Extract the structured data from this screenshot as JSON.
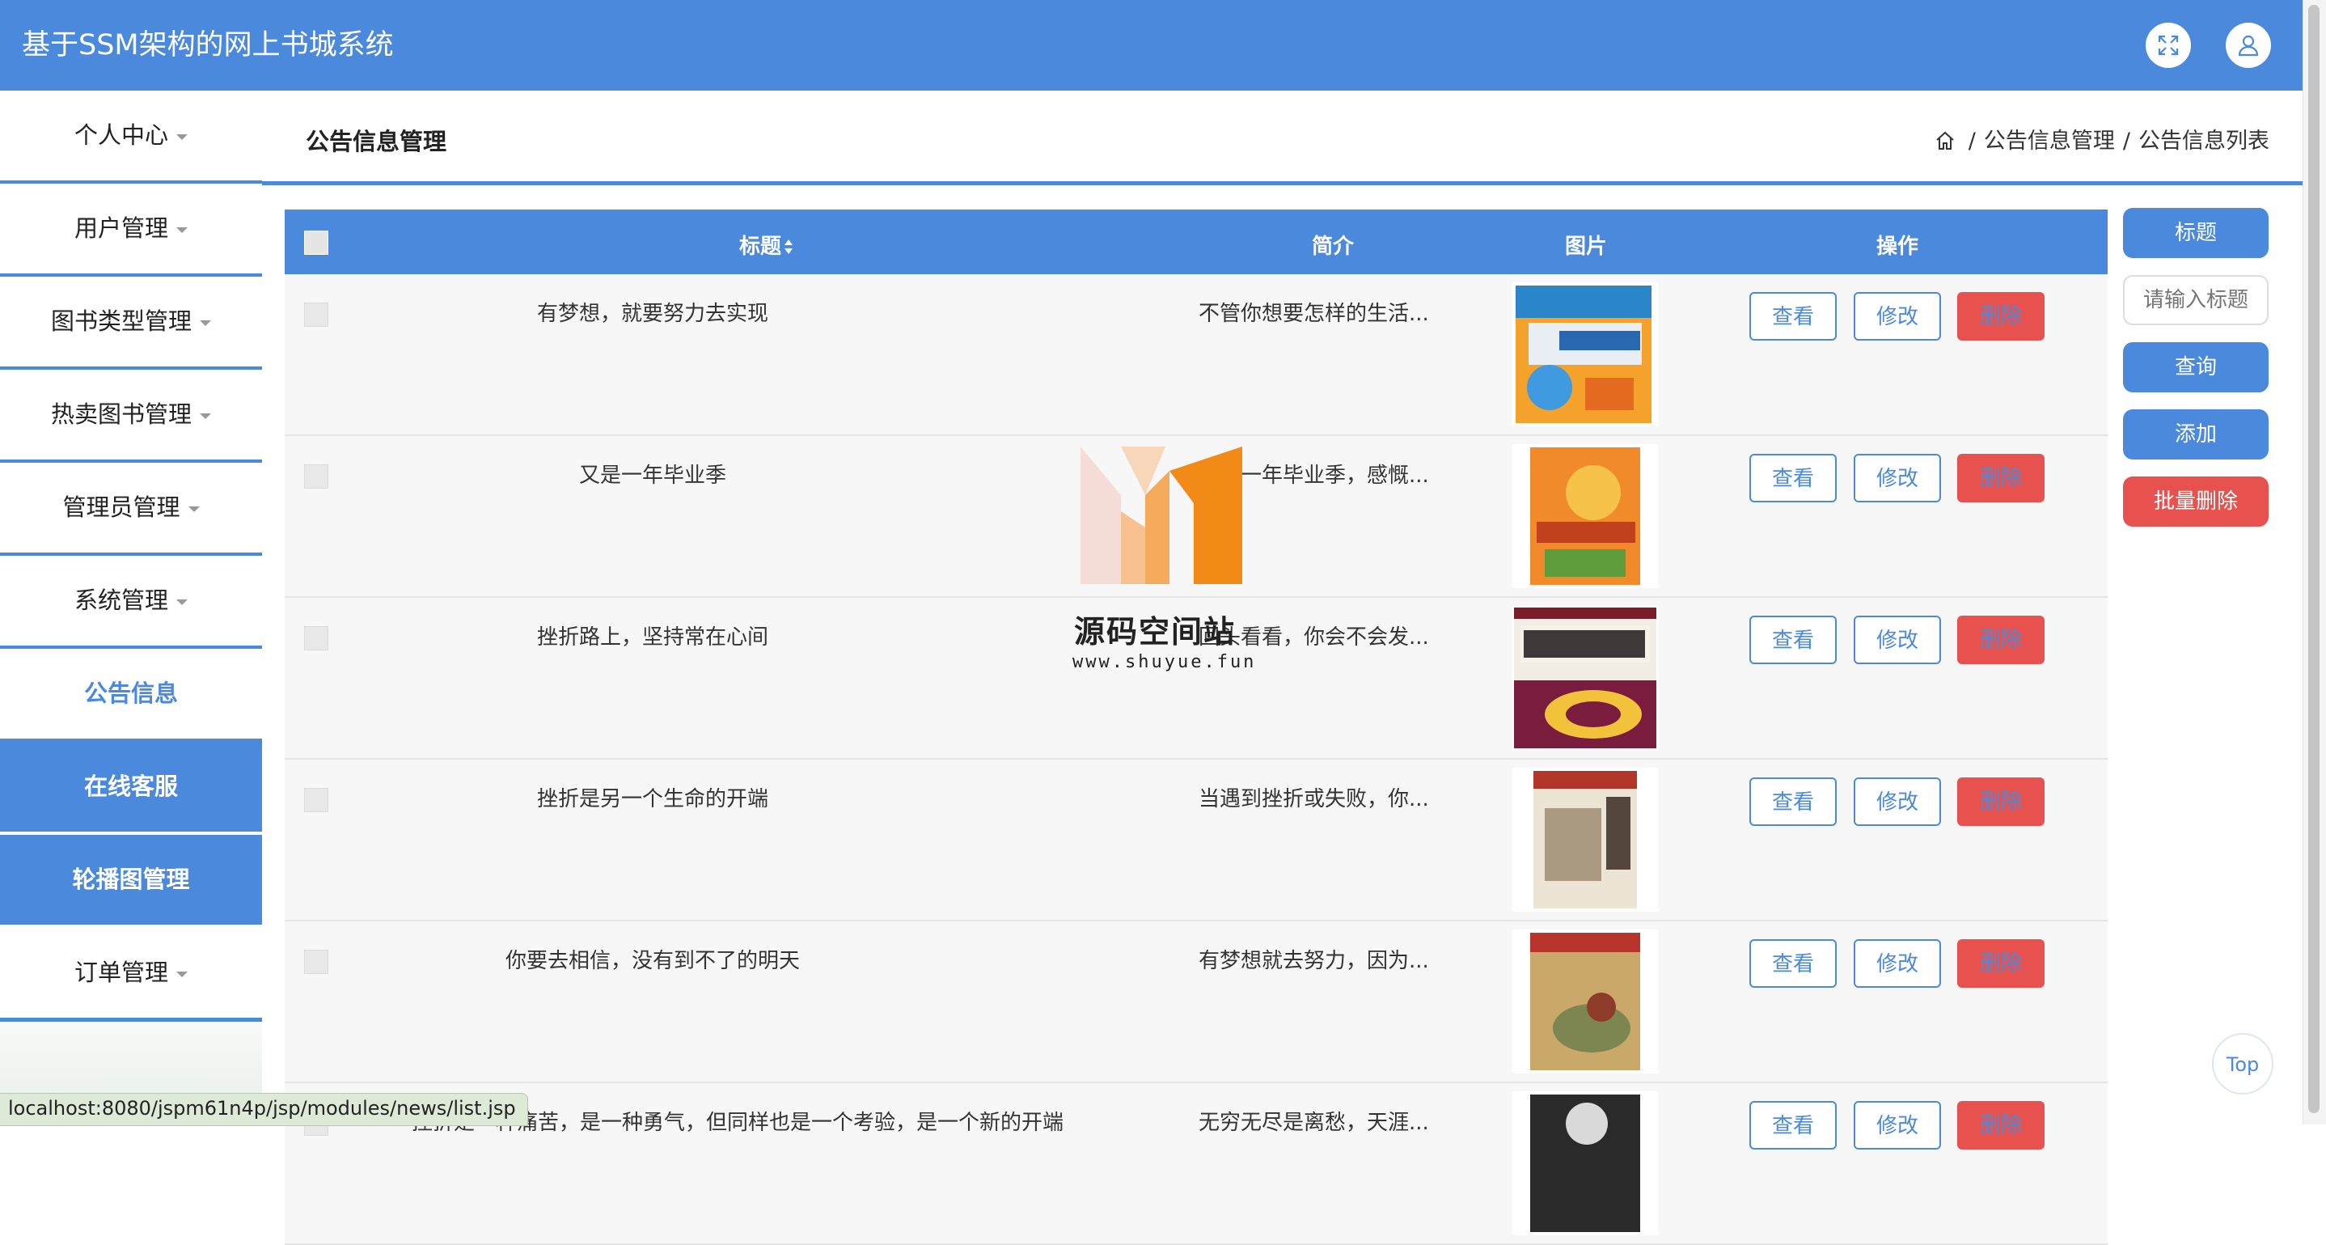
{
  "app": {
    "title": "基于SSM架构的网上书城系统"
  },
  "header": {
    "icons": [
      "fullscreen-icon",
      "user-icon"
    ]
  },
  "sidebar": {
    "items": [
      {
        "label": "个人中心",
        "caret": true
      },
      {
        "label": "用户管理",
        "caret": true
      },
      {
        "label": "图书类型管理",
        "caret": true
      },
      {
        "label": "热卖图书管理",
        "caret": true
      },
      {
        "label": "管理员管理",
        "caret": true
      },
      {
        "label": "系统管理",
        "caret": true
      },
      {
        "label": "公告信息",
        "state": "active"
      },
      {
        "label": "在线客服",
        "state": "filled"
      },
      {
        "label": "轮播图管理",
        "state": "filled"
      },
      {
        "label": "订单管理",
        "caret": true
      }
    ]
  },
  "page": {
    "title": "公告信息管理"
  },
  "breadcrumb": {
    "home_icon": "home-icon",
    "items": [
      "公告信息管理",
      "公告信息列表"
    ],
    "separator": "/"
  },
  "table": {
    "headers": {
      "title": "标题",
      "summary": "简介",
      "image": "图片",
      "actions": "操作"
    },
    "sort_icon": "sort-icon",
    "actions": {
      "view": "查看",
      "edit": "修改",
      "delete": "删除"
    },
    "rows": [
      {
        "title": "有梦想，就要努力去实现",
        "summary": "不管你想要怎样的生活..."
      },
      {
        "title": "又是一年毕业季",
        "summary": "又是一年毕业季，感慨..."
      },
      {
        "title": "挫折路上，坚持常在心间",
        "summary": "回头看看，你会不会发..."
      },
      {
        "title": "挫折是另一个生命的开端",
        "summary": "当遇到挫折或失败，你..."
      },
      {
        "title": "你要去相信，没有到不了的明天",
        "summary": "有梦想就去努力，因为..."
      },
      {
        "title": "挫折是一种痛苦，是一种勇气，但同样也是一个考验，是一个新的开端",
        "summary": "无穷无尽是离愁，天涯..."
      }
    ]
  },
  "search": {
    "field_label": "标题",
    "placeholder": "请输入标题",
    "query": "查询",
    "add": "添加",
    "batch_delete": "批量删除"
  },
  "top_button": "Top",
  "status_url": "localhost:8080/jspm61n4p/jsp/modules/news/list.jsp",
  "watermark": {
    "name": "源码空间站",
    "url": "www.shuyue.fun"
  },
  "colors": {
    "primary": "#4b89dc",
    "danger": "#e8524e",
    "background": "#ffffff"
  }
}
